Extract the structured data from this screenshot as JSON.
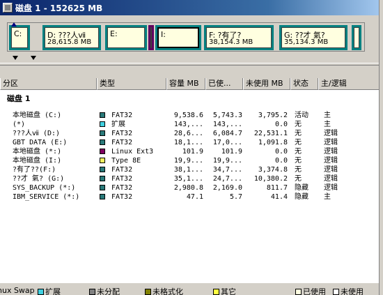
{
  "window": {
    "title": "磁盘 1 - 152625 MB"
  },
  "disk_map": {
    "partitions": [
      {
        "label": "C:",
        "size": "",
        "kind": "fat32",
        "selected": false
      },
      {
        "label": "D: ???人ⅶ",
        "size": "28,615.8 MB",
        "kind": "fat32",
        "selected": false
      },
      {
        "label": "E:",
        "size": "",
        "kind": "fat32",
        "selected": false
      },
      {
        "label": "",
        "size": "",
        "kind": "linux",
        "selected": false
      },
      {
        "label": "I:",
        "size": "",
        "kind": "type8e",
        "selected": true
      },
      {
        "label": "F: ?有了?",
        "size": "38,154.3 MB",
        "kind": "fat32",
        "selected": false
      },
      {
        "label": "G: ??才 氣?",
        "size": "35,134.3 MB",
        "kind": "fat32",
        "selected": false
      },
      {
        "label": "",
        "size": "",
        "kind": "fat32",
        "selected": false
      }
    ]
  },
  "columns": [
    "分区",
    "类型",
    "容量 MB",
    "已使...",
    "未使用 MB",
    "状态",
    "主/逻辑"
  ],
  "group": "磁盘 1",
  "rows": [
    {
      "name": "本地磁盘 (C:)",
      "type": "FAT32",
      "cap": "9,538.6",
      "used": "5,743.3",
      "free": "3,795.2",
      "state": "活动",
      "role": "主",
      "color": "#2a7a7a"
    },
    {
      "name": "(*)",
      "type": "扩展",
      "cap": "143,...",
      "used": "143,...",
      "free": "0.0",
      "state": "无",
      "role": "主",
      "color": "#40d0e0"
    },
    {
      "name": "???人ⅶ (D:)",
      "type": "FAT32",
      "cap": "28,6...",
      "used": "6,084.7",
      "free": "22,531.1",
      "state": "无",
      "role": "逻辑",
      "color": "#2a7a7a"
    },
    {
      "name": "GBT DATA (E:)",
      "type": "FAT32",
      "cap": "18,1...",
      "used": "17,0...",
      "free": "1,091.8",
      "state": "无",
      "role": "逻辑",
      "color": "#2a7a7a"
    },
    {
      "name": "本地磁盘 (*:)",
      "type": "Linux Ext3",
      "cap": "101.9",
      "used": "101.9",
      "free": "0.0",
      "state": "无",
      "role": "逻辑",
      "color": "#800060"
    },
    {
      "name": "本地磁盘 (I:)",
      "type": "Type 8E",
      "cap": "19,9...",
      "used": "19,9...",
      "free": "0.0",
      "state": "无",
      "role": "逻辑",
      "color": "#f0f060"
    },
    {
      "name": "?有了??(F:)",
      "type": "FAT32",
      "cap": "38,1...",
      "used": "34,7...",
      "free": "3,374.8",
      "state": "无",
      "role": "逻辑",
      "color": "#2a7a7a"
    },
    {
      "name": "??才 氣? (G:)",
      "type": "FAT32",
      "cap": "35,1...",
      "used": "24,7...",
      "free": "10,380.2",
      "state": "无",
      "role": "逻辑",
      "color": "#2a7a7a"
    },
    {
      "name": "SYS_BACKUP (*:)",
      "type": "FAT32",
      "cap": "2,980.8",
      "used": "2,169.0",
      "free": "811.7",
      "state": "隐藏",
      "role": "逻辑",
      "color": "#2a7a7a"
    },
    {
      "name": "IBM_SERVICE (*:)",
      "type": "FAT32",
      "cap": "47.1",
      "used": "5.7",
      "free": "41.4",
      "state": "隐藏",
      "role": "主",
      "color": "#2a7a7a"
    }
  ],
  "legend": [
    {
      "label": "nux Swap",
      "color": ""
    },
    {
      "label": "扩展",
      "color": "#40d0e0"
    },
    {
      "label": "未分配",
      "color": "#808080"
    },
    {
      "label": "未格式化",
      "color": "#808000"
    },
    {
      "label": "其它",
      "color": "#ffff40"
    },
    {
      "label": "已使用",
      "color": "#ffffe0"
    },
    {
      "label": "未使用",
      "color": "#ffffff"
    }
  ]
}
